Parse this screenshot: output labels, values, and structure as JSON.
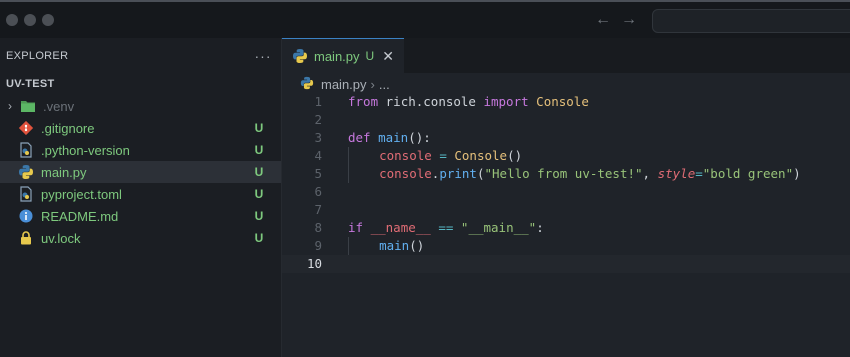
{
  "titlebar": {
    "back_icon": "arrow-left-icon",
    "forward_icon": "arrow-right-icon"
  },
  "sidebar": {
    "header": "EXPLORER",
    "more": "···",
    "section": "UV-TEST",
    "items": [
      {
        "name": ".venv",
        "type": "folder",
        "icon": "folder-icon",
        "status": ""
      },
      {
        "name": ".gitignore",
        "type": "file",
        "icon": "git-icon",
        "status": "U"
      },
      {
        "name": ".python-version",
        "type": "file",
        "icon": "python-file-icon",
        "status": "U"
      },
      {
        "name": "main.py",
        "type": "file",
        "icon": "python-icon",
        "status": "U"
      },
      {
        "name": "pyproject.toml",
        "type": "file",
        "icon": "python-file-icon",
        "status": "U"
      },
      {
        "name": "README.md",
        "type": "file",
        "icon": "info-icon",
        "status": "U"
      },
      {
        "name": "uv.lock",
        "type": "file",
        "icon": "lock-icon",
        "status": "U"
      }
    ]
  },
  "editor": {
    "tab": {
      "label": "main.py",
      "status": "U",
      "close": "✕"
    },
    "breadcrumb": {
      "file": "main.py",
      "sep": "›",
      "rest": "..."
    },
    "line_numbers": [
      "1",
      "2",
      "3",
      "4",
      "5",
      "6",
      "7",
      "8",
      "9",
      "10"
    ],
    "code": {
      "l1_from": "from",
      "l1_mod": "rich.console",
      "l1_import": "import",
      "l1_cls": "Console",
      "l3_def": "def",
      "l3_fn": "main",
      "l3_rest": "():",
      "l4_var": "console",
      "l4_eq": " = ",
      "l4_cls": "Console",
      "l4_rest": "()",
      "l5_var": "console",
      "l5_dot": ".",
      "l5_fn": "print",
      "l5_open": "(",
      "l5_str": "\"Hello from uv-test!\"",
      "l5_comma": ", ",
      "l5_param": "style",
      "l5_eq": "=",
      "l5_str2": "\"bold green\"",
      "l5_close": ")",
      "l8_if": "if",
      "l8_name": "__name__",
      "l8_op": " == ",
      "l8_str": "\"__main__\"",
      "l8_colon": ":",
      "l9_fn": "main",
      "l9_rest": "()"
    }
  },
  "colors": {
    "untracked": "#7ec97e",
    "keyword": "#c678dd",
    "class": "#e5c07b",
    "function": "#61afef",
    "string": "#98c379"
  }
}
